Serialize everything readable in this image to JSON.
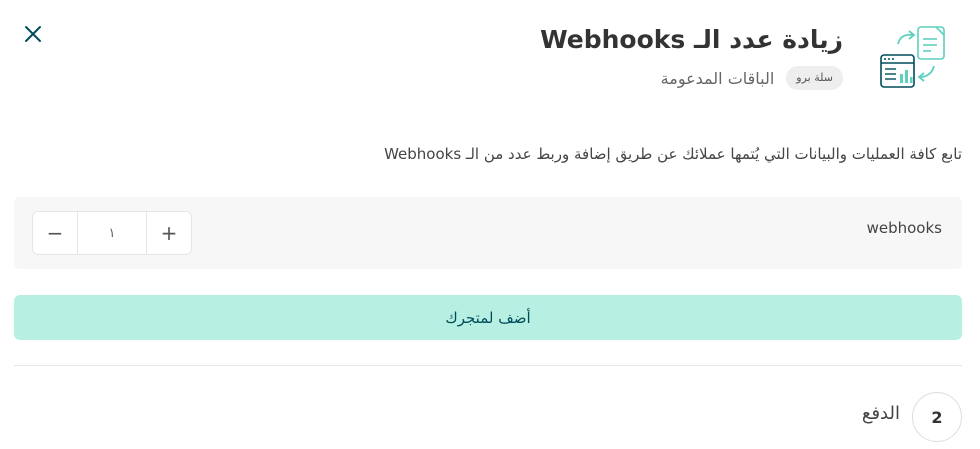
{
  "header": {
    "title": "زيادة عدد الـ Webhooks",
    "subtitle": "الباقات المدعومة",
    "plan_badge": "سلة برو",
    "close_icon": "close-icon",
    "feature_icon": "webhook-sync-icon"
  },
  "description": "تابع كافة العمليات والبيانات التي يُتمها عملائك عن طريق إضافة وربط عدد من الـ Webhooks",
  "quantity": {
    "label": "webhooks",
    "value": "١",
    "decrement_symbol": "−",
    "increment_symbol": "+"
  },
  "add_button_label": "أضف لمتجرك",
  "step": {
    "number": "2",
    "label": "الدفع"
  },
  "colors": {
    "accent": "#b7f0e3",
    "accent_text": "#004d5a",
    "icon_teal": "#5dd0be",
    "icon_dark": "#004d5a"
  }
}
